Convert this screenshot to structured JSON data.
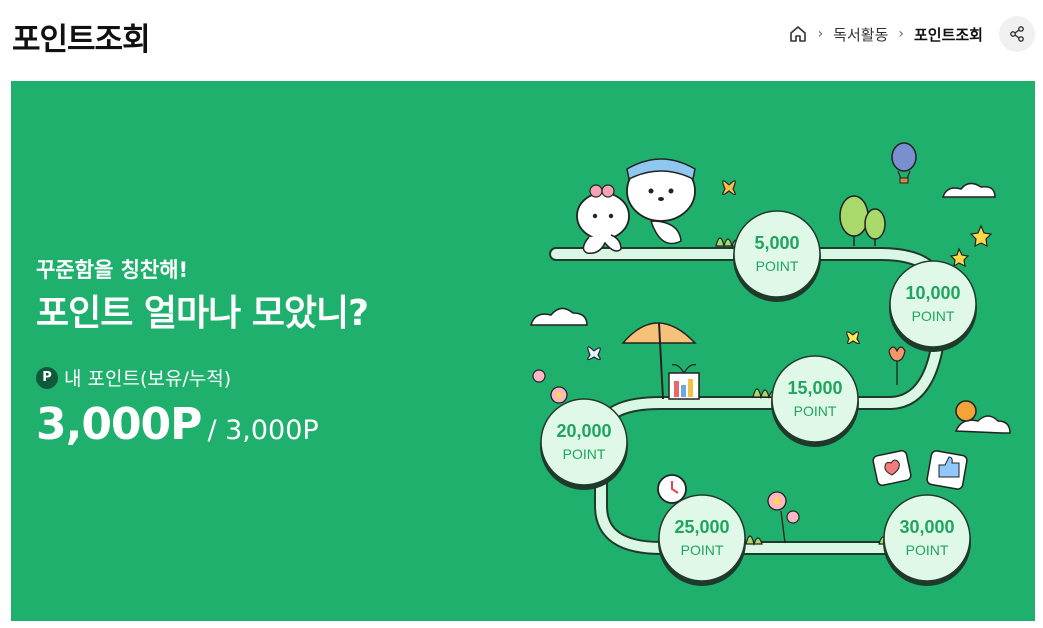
{
  "header": {
    "title": "포인트조회",
    "breadcrumb": [
      "독서활동",
      "포인트조회"
    ]
  },
  "banner": {
    "eyebrow": "꾸준함을 칭찬해!",
    "headline": "포인트 얼마나 모았니?",
    "badge": "P",
    "point_label": "내 포인트(보유/누적)",
    "owned_points": "3,000P",
    "total_points": "/ 3,000P",
    "background_color": "#20b06e"
  },
  "milestones": [
    {
      "amount": "5,000",
      "unit": "POINT"
    },
    {
      "amount": "10,000",
      "unit": "POINT"
    },
    {
      "amount": "15,000",
      "unit": "POINT"
    },
    {
      "amount": "20,000",
      "unit": "POINT"
    },
    {
      "amount": "25,000",
      "unit": "POINT"
    },
    {
      "amount": "30,000",
      "unit": "POINT"
    }
  ],
  "icons": [
    "home-icon",
    "share-icon"
  ]
}
